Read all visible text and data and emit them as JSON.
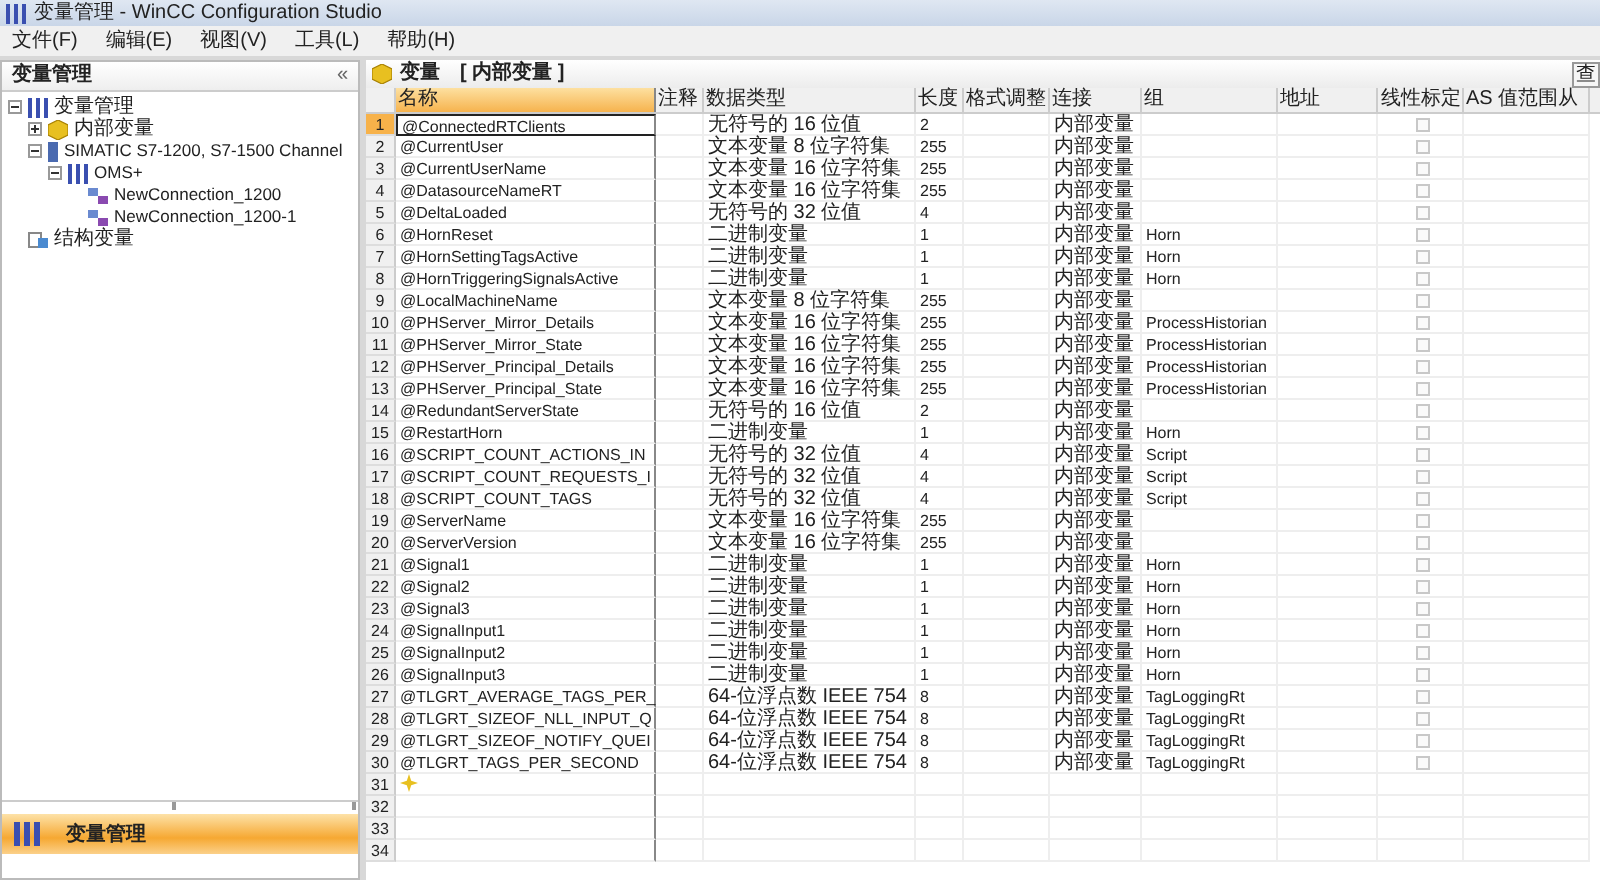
{
  "window": {
    "title": "变量管理 - WinCC Configuration Studio"
  },
  "menu": [
    "文件(F)",
    "编辑(E)",
    "视图(V)",
    "工具(L)",
    "帮助(H)"
  ],
  "sidebar": {
    "title": "变量管理",
    "collapse": "«",
    "tree": [
      {
        "label": "变量管理",
        "kind": "root",
        "expanded": true,
        "children": [
          {
            "label": "内部变量",
            "kind": "internal",
            "expanded": false,
            "selected": false
          },
          {
            "label": "SIMATIC S7-1200, S7-1500 Channel",
            "kind": "channel",
            "expanded": true,
            "children": [
              {
                "label": "OMS+",
                "kind": "driver",
                "expanded": true,
                "children": [
                  {
                    "label": "NewConnection_1200",
                    "kind": "connection"
                  },
                  {
                    "label": "NewConnection_1200-1",
                    "kind": "connection"
                  }
                ]
              }
            ]
          }
        ]
      },
      {
        "label": "结构变量",
        "kind": "struct"
      }
    ],
    "nav": {
      "label": "变量管理",
      "selected": true
    }
  },
  "table": {
    "title": "变量",
    "subtitle": "[ 内部变量 ]",
    "search": "查",
    "columns": [
      "名称",
      "注释",
      "数据类型",
      "长度",
      "格式调整",
      "连接",
      "组",
      "地址",
      "线性标定",
      "AS 值范围从"
    ],
    "rows": [
      {
        "kind": "tag",
        "number": "1",
        "name": "@ConnectedRTClients",
        "data_type": "无符号的 16 位值",
        "length": "2",
        "connection": "内部变量",
        "group": "",
        "checked": false,
        "selected": true
      },
      {
        "kind": "tag",
        "number": "2",
        "name": "@CurrentUser",
        "data_type": "文本变量 8 位字符集",
        "length": "255",
        "connection": "内部变量",
        "group": "",
        "checked": false,
        "selected": false
      },
      {
        "kind": "tag",
        "number": "3",
        "name": "@CurrentUserName",
        "data_type": "文本变量 16 位字符集",
        "length": "255",
        "connection": "内部变量",
        "group": "",
        "checked": false,
        "selected": false
      },
      {
        "kind": "tag",
        "number": "4",
        "name": "@DatasourceNameRT",
        "data_type": "文本变量 16 位字符集",
        "length": "255",
        "connection": "内部变量",
        "group": "",
        "checked": false,
        "selected": false
      },
      {
        "kind": "tag",
        "number": "5",
        "name": "@DeltaLoaded",
        "data_type": "无符号的 32 位值",
        "length": "4",
        "connection": "内部变量",
        "group": "",
        "checked": false,
        "selected": false
      },
      {
        "kind": "tag",
        "number": "6",
        "name": "@HornReset",
        "data_type": "二进制变量",
        "length": "1",
        "connection": "内部变量",
        "group": "Horn",
        "checked": false,
        "selected": false
      },
      {
        "kind": "tag",
        "number": "7",
        "name": "@HornSettingTagsActive",
        "data_type": "二进制变量",
        "length": "1",
        "connection": "内部变量",
        "group": "Horn",
        "checked": false,
        "selected": false
      },
      {
        "kind": "tag",
        "number": "8",
        "name": "@HornTriggeringSignalsActive",
        "data_type": "二进制变量",
        "length": "1",
        "connection": "内部变量",
        "group": "Horn",
        "checked": false,
        "selected": false
      },
      {
        "kind": "tag",
        "number": "9",
        "name": "@LocalMachineName",
        "data_type": "文本变量 8 位字符集",
        "length": "255",
        "connection": "内部变量",
        "group": "",
        "checked": false,
        "selected": false
      },
      {
        "kind": "tag",
        "number": "10",
        "name": "@PHServer_Mirror_Details",
        "data_type": "文本变量 16 位字符集",
        "length": "255",
        "connection": "内部变量",
        "group": "ProcessHistorian",
        "checked": false,
        "selected": false
      },
      {
        "kind": "tag",
        "number": "11",
        "name": "@PHServer_Mirror_State",
        "data_type": "文本变量 16 位字符集",
        "length": "255",
        "connection": "内部变量",
        "group": "ProcessHistorian",
        "checked": false,
        "selected": false
      },
      {
        "kind": "tag",
        "number": "12",
        "name": "@PHServer_Principal_Details",
        "data_type": "文本变量 16 位字符集",
        "length": "255",
        "connection": "内部变量",
        "group": "ProcessHistorian",
        "checked": false,
        "selected": false
      },
      {
        "kind": "tag",
        "number": "13",
        "name": "@PHServer_Principal_State",
        "data_type": "文本变量 16 位字符集",
        "length": "255",
        "connection": "内部变量",
        "group": "ProcessHistorian",
        "checked": false,
        "selected": false
      },
      {
        "kind": "tag",
        "number": "14",
        "name": "@RedundantServerState",
        "data_type": "无符号的 16 位值",
        "length": "2",
        "connection": "内部变量",
        "group": "",
        "checked": false,
        "selected": false
      },
      {
        "kind": "tag",
        "number": "15",
        "name": "@RestartHorn",
        "data_type": "二进制变量",
        "length": "1",
        "connection": "内部变量",
        "group": "Horn",
        "checked": false,
        "selected": false
      },
      {
        "kind": "tag",
        "number": "16",
        "name": "@SCRIPT_COUNT_ACTIONS_IN",
        "data_type": "无符号的 32 位值",
        "length": "4",
        "connection": "内部变量",
        "group": "Script",
        "checked": false,
        "selected": false
      },
      {
        "kind": "tag",
        "number": "17",
        "name": "@SCRIPT_COUNT_REQUESTS_I",
        "data_type": "无符号的 32 位值",
        "length": "4",
        "connection": "内部变量",
        "group": "Script",
        "checked": false,
        "selected": false
      },
      {
        "kind": "tag",
        "number": "18",
        "name": "@SCRIPT_COUNT_TAGS",
        "data_type": "无符号的 32 位值",
        "length": "4",
        "connection": "内部变量",
        "group": "Script",
        "checked": false,
        "selected": false
      },
      {
        "kind": "tag",
        "number": "19",
        "name": "@ServerName",
        "data_type": "文本变量 16 位字符集",
        "length": "255",
        "connection": "内部变量",
        "group": "",
        "checked": false,
        "selected": false
      },
      {
        "kind": "tag",
        "number": "20",
        "name": "@ServerVersion",
        "data_type": "文本变量 16 位字符集",
        "length": "255",
        "connection": "内部变量",
        "group": "",
        "checked": false,
        "selected": false
      },
      {
        "kind": "tag",
        "number": "21",
        "name": "@Signal1",
        "data_type": "二进制变量",
        "length": "1",
        "connection": "内部变量",
        "group": "Horn",
        "checked": false,
        "selected": false
      },
      {
        "kind": "tag",
        "number": "22",
        "name": "@Signal2",
        "data_type": "二进制变量",
        "length": "1",
        "connection": "内部变量",
        "group": "Horn",
        "checked": false,
        "selected": false
      },
      {
        "kind": "tag",
        "number": "23",
        "name": "@Signal3",
        "data_type": "二进制变量",
        "length": "1",
        "connection": "内部变量",
        "group": "Horn",
        "checked": false,
        "selected": false
      },
      {
        "kind": "tag",
        "number": "24",
        "name": "@SignalInput1",
        "data_type": "二进制变量",
        "length": "1",
        "connection": "内部变量",
        "group": "Horn",
        "checked": false,
        "selected": false
      },
      {
        "kind": "tag",
        "number": "25",
        "name": "@SignalInput2",
        "data_type": "二进制变量",
        "length": "1",
        "connection": "内部变量",
        "group": "Horn",
        "checked": false,
        "selected": false
      },
      {
        "kind": "tag",
        "number": "26",
        "name": "@SignalInput3",
        "data_type": "二进制变量",
        "length": "1",
        "connection": "内部变量",
        "group": "Horn",
        "checked": false,
        "selected": false
      },
      {
        "kind": "tag",
        "number": "27",
        "name": "@TLGRT_AVERAGE_TAGS_PER_",
        "data_type": "64-位浮点数 IEEE 754",
        "length": "8",
        "connection": "内部变量",
        "group": "TagLoggingRt",
        "checked": false,
        "selected": false
      },
      {
        "kind": "tag",
        "number": "28",
        "name": "@TLGRT_SIZEOF_NLL_INPUT_Q",
        "data_type": "64-位浮点数 IEEE 754",
        "length": "8",
        "connection": "内部变量",
        "group": "TagLoggingRt",
        "checked": false,
        "selected": false
      },
      {
        "kind": "tag",
        "number": "29",
        "name": "@TLGRT_SIZEOF_NOTIFY_QUEI",
        "data_type": "64-位浮点数 IEEE 754",
        "length": "8",
        "connection": "内部变量",
        "group": "TagLoggingRt",
        "checked": false,
        "selected": false
      },
      {
        "kind": "tag",
        "number": "30",
        "name": "@TLGRT_TAGS_PER_SECOND",
        "data_type": "64-位浮点数 IEEE 754",
        "length": "8",
        "connection": "内部变量",
        "group": "TagLoggingRt",
        "checked": false,
        "selected": false
      },
      {
        "kind": "new",
        "number": "31"
      },
      {
        "kind": "empty",
        "number": "32"
      },
      {
        "kind": "empty",
        "number": "33"
      },
      {
        "kind": "empty",
        "number": "34"
      }
    ]
  }
}
